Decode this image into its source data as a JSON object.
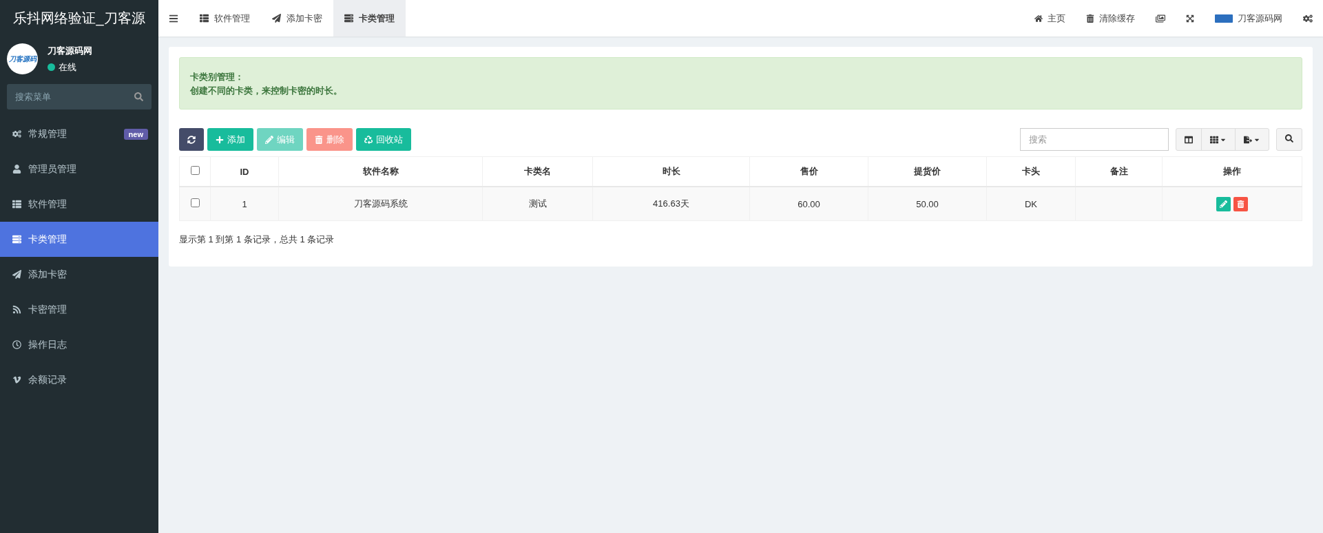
{
  "sidebar": {
    "title": "乐抖网络验证_刀客源",
    "user": {
      "avatar_text": "刀客源码",
      "name": "刀客源码网",
      "status": "在线",
      "online": true
    },
    "search": {
      "placeholder": "搜索菜单"
    },
    "items": [
      {
        "label": "常规管理",
        "badge": "new",
        "selected": false
      },
      {
        "label": "管理员管理",
        "selected": false
      },
      {
        "label": "软件管理",
        "selected": false
      },
      {
        "label": "卡类管理",
        "selected": true
      },
      {
        "label": "添加卡密",
        "selected": false
      },
      {
        "label": "卡密管理",
        "selected": false
      },
      {
        "label": "操作日志",
        "selected": false
      },
      {
        "label": "余额记录",
        "selected": false
      }
    ]
  },
  "topbar": {
    "tabs": [
      {
        "label": "软件管理",
        "selected": false
      },
      {
        "label": "添加卡密",
        "selected": false
      },
      {
        "label": "卡类管理",
        "selected": true
      }
    ],
    "links": [
      {
        "label": "主页"
      },
      {
        "label": "清除缓存"
      }
    ],
    "account": "刀客源码网"
  },
  "alert": {
    "title": "卡类别管理：",
    "text": "创建不同的卡类，来控制卡密的时长。"
  },
  "toolbar": {
    "buttons": [
      {
        "kind": "refresh",
        "disabled": false
      },
      {
        "kind": "add",
        "label": "添加",
        "disabled": false
      },
      {
        "kind": "edit",
        "label": "编辑",
        "disabled": true
      },
      {
        "kind": "delete",
        "label": "删除",
        "disabled": true
      },
      {
        "kind": "recycle",
        "label": "回收站",
        "disabled": false
      }
    ],
    "search": {
      "placeholder": "搜索"
    }
  },
  "table": {
    "select_all": {
      "checked": false
    },
    "columns": [
      "ID",
      "软件名称",
      "卡类名",
      "时长",
      "售价",
      "提货价",
      "卡头",
      "备注",
      "操作"
    ],
    "rows": [
      {
        "checked": false,
        "cells": [
          "1",
          "刀客源码系统",
          "测试",
          "416.63天",
          "60.00",
          "50.00",
          "DK",
          ""
        ]
      }
    ]
  },
  "pagination": "显示第 1 到第 1 条记录，总共 1 条记录"
}
